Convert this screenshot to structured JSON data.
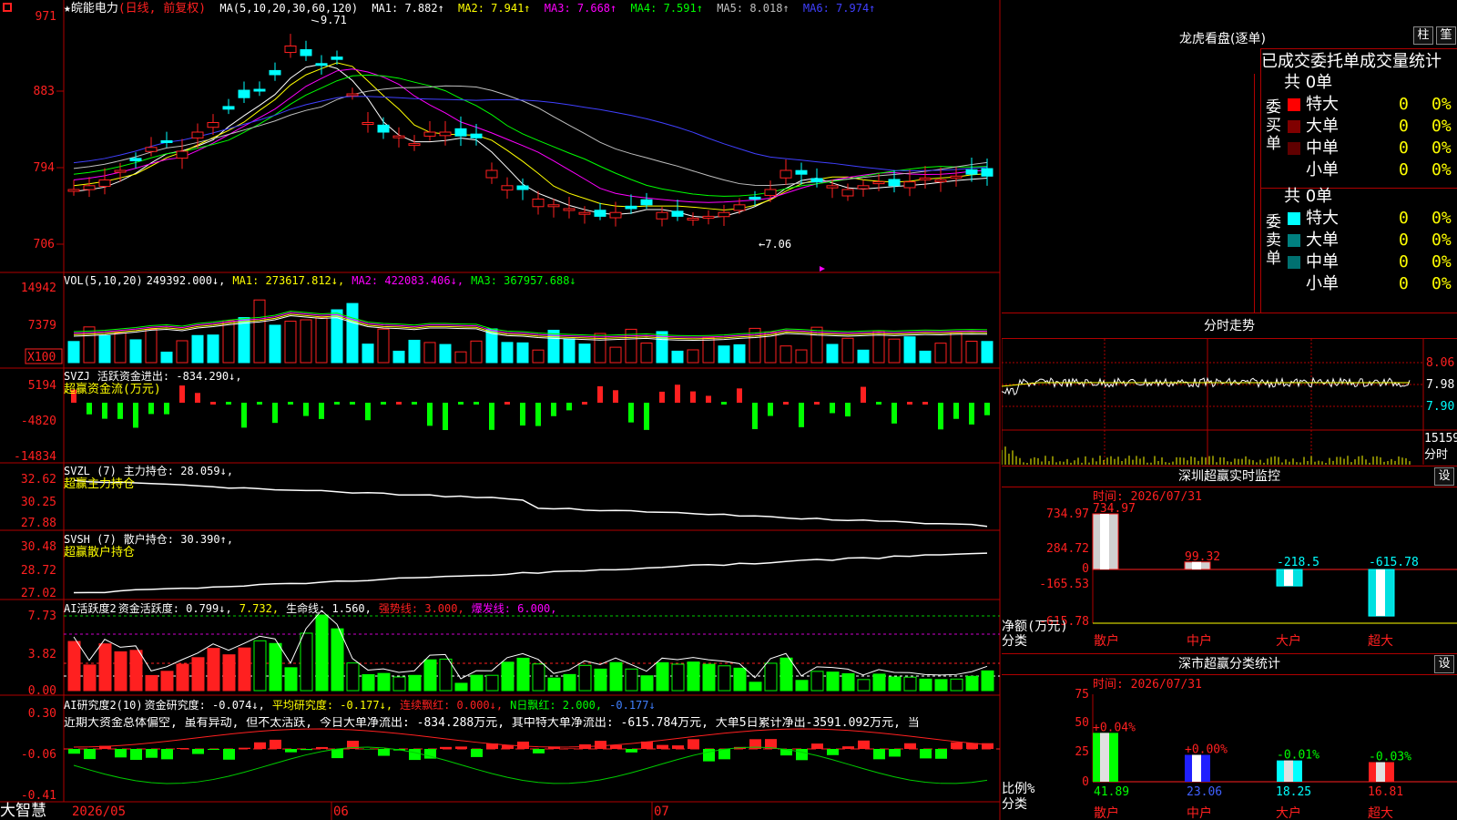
{
  "header": {
    "top_price": "971",
    "stock": "★皖能电力",
    "mode": "(日线, 前复权)",
    "ma_params": "MA(5,10,20,30,60,120)",
    "ma1": "MA1: 7.882↑",
    "ma2": "MA2: 7.941↑",
    "ma3": "MA3: 7.668↑",
    "ma4": "MA4: 7.591↑",
    "ma5": "MA5: 8.018↑",
    "ma6": "MA6: 7.974↑",
    "high_mark": "9.71",
    "low_mark": "←7.06",
    "price_ticks": [
      "883",
      "794",
      "706"
    ]
  },
  "vol": {
    "label": "VOL(5,10,20)",
    "value": "249392.000↓,",
    "ma1": "MA1: 273617.812↓,",
    "ma2": "MA2: 422083.406↓,",
    "ma3": "MA3: 367957.688↓",
    "ticks": [
      "14942",
      "7379"
    ],
    "unit": "X100"
  },
  "svzj": {
    "label": "SVZJ",
    "line": "活跃资金进出: -834.290↓,",
    "sub": "超赢资金流(万元)",
    "ticks": [
      "5194",
      "-4820",
      "-14834"
    ]
  },
  "svzl": {
    "label": "SVZL (7)",
    "line": "主力持仓: 28.059↓,",
    "sub": "超赢主力持仓",
    "ticks": [
      "32.62",
      "30.25",
      "27.88"
    ]
  },
  "svsh": {
    "label": "SVSH (7)",
    "line": "散户持仓: 30.390↑,",
    "sub": "超赢散户持仓",
    "ticks": [
      "30.48",
      "28.72",
      "27.02"
    ]
  },
  "ai2": {
    "label": "AI活跃度2",
    "a": "资金活跃度: 0.799↓,",
    "b": "7.732,",
    "c": "生命线: 1.560,",
    "d": "强势线: 3.000,",
    "e": "爆发线: 6.000,",
    "ticks": [
      "7.73",
      "3.82",
      "0.00"
    ]
  },
  "ai10": {
    "label": "AI研究度2(10)",
    "a": "资金研究度: -0.074↓,",
    "b": "平均研究度: -0.177↓,",
    "c": "连续飘红: 0.000↓,",
    "d": "N日飘红: 2.000,",
    "e": "-0.177↓",
    "comment": "近期大资金总体偏空, 虽有异动, 但不太活跃, 今日大单净流出: -834.288万元, 其中特大单净流出: -615.784万元, 大单5日累计净出-3591.092万元, 当",
    "ticks": [
      "0.30",
      "-0.06",
      "-0.41"
    ]
  },
  "bottom": {
    "brand": "大智慧",
    "dates": [
      "2026/05",
      "06",
      "07"
    ]
  },
  "dragon": {
    "title": "龙虎看盘(逐单)",
    "btn1": "柱",
    "btn2": "筀",
    "subtitle": "已成交委托单成交量统计",
    "buy": {
      "side": "委买单",
      "total": "共 0单",
      "rows": [
        {
          "label": "特大",
          "v": "0",
          "p": "0%",
          "c": "#ff0000"
        },
        {
          "label": "大单",
          "v": "0",
          "p": "0%",
          "c": "#800000"
        },
        {
          "label": "中单",
          "v": "0",
          "p": "0%",
          "c": "#600000"
        },
        {
          "label": "小单",
          "v": "0",
          "p": "0%",
          "c": "#000000"
        }
      ]
    },
    "sell": {
      "side": "委卖单",
      "total": "共 0单",
      "rows": [
        {
          "label": "特大",
          "v": "0",
          "p": "0%",
          "c": "#00ffff"
        },
        {
          "label": "大单",
          "v": "0",
          "p": "0%",
          "c": "#008080"
        },
        {
          "label": "中单",
          "v": "0",
          "p": "0%",
          "c": "#007070"
        },
        {
          "label": "小单",
          "v": "0",
          "p": "0%",
          "c": "#000000"
        }
      ]
    }
  },
  "intraday": {
    "title": "分时走势",
    "ticks": [
      "8.06",
      "7.98",
      "7.90"
    ],
    "vol_tick": "15159",
    "vol_label": "分时"
  },
  "monitor": {
    "title": "深圳超赢实时监控",
    "btn": "设",
    "time": "时间: 2026/07/31",
    "ticks": [
      "734.97",
      "284.72",
      "0",
      "-165.53",
      "-615.78"
    ],
    "unit": "净额(万元)",
    "cat_label": "分类",
    "cats": [
      "散户",
      "中户",
      "大户",
      "超大"
    ],
    "values": [
      "734.97",
      "99.32",
      "-218.5",
      "-615.78"
    ]
  },
  "classify": {
    "title": "深市超赢分类统计",
    "btn": "设",
    "time": "时间: 2026/07/31",
    "ticks": [
      "75",
      "50",
      "25",
      "0"
    ],
    "unit": "比例%",
    "cat_label": "分类",
    "cats": [
      "散户",
      "中户",
      "大户",
      "超大"
    ],
    "tops": [
      "+0.04%",
      "+0.00%",
      "-0.01%",
      "-0.03%"
    ],
    "vals": [
      "41.89",
      "23.06",
      "18.25",
      "16.81"
    ]
  }
}
